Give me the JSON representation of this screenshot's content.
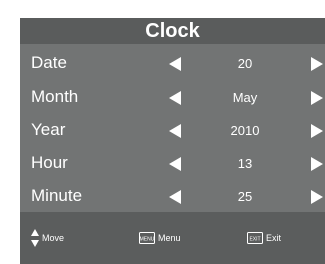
{
  "title": "Clock",
  "rows": [
    {
      "label": "Date",
      "value": "20"
    },
    {
      "label": "Month",
      "value": "May"
    },
    {
      "label": "Year",
      "value": "2010"
    },
    {
      "label": "Hour",
      "value": "13"
    },
    {
      "label": "Minute",
      "value": "25"
    }
  ],
  "footer": {
    "move": {
      "label": "Move",
      "icon": "up-down-arrows-icon"
    },
    "menu": {
      "label": "Menu",
      "icon": "menu-key-icon",
      "key_text": "MENU"
    },
    "exit": {
      "label": "Exit",
      "icon": "exit-key-icon",
      "key_text": "EXIT"
    }
  },
  "colors": {
    "panel": "#727474",
    "title_bar": "#5a5c5c",
    "footer": "#5b5d5d",
    "text": "#ffffff"
  }
}
